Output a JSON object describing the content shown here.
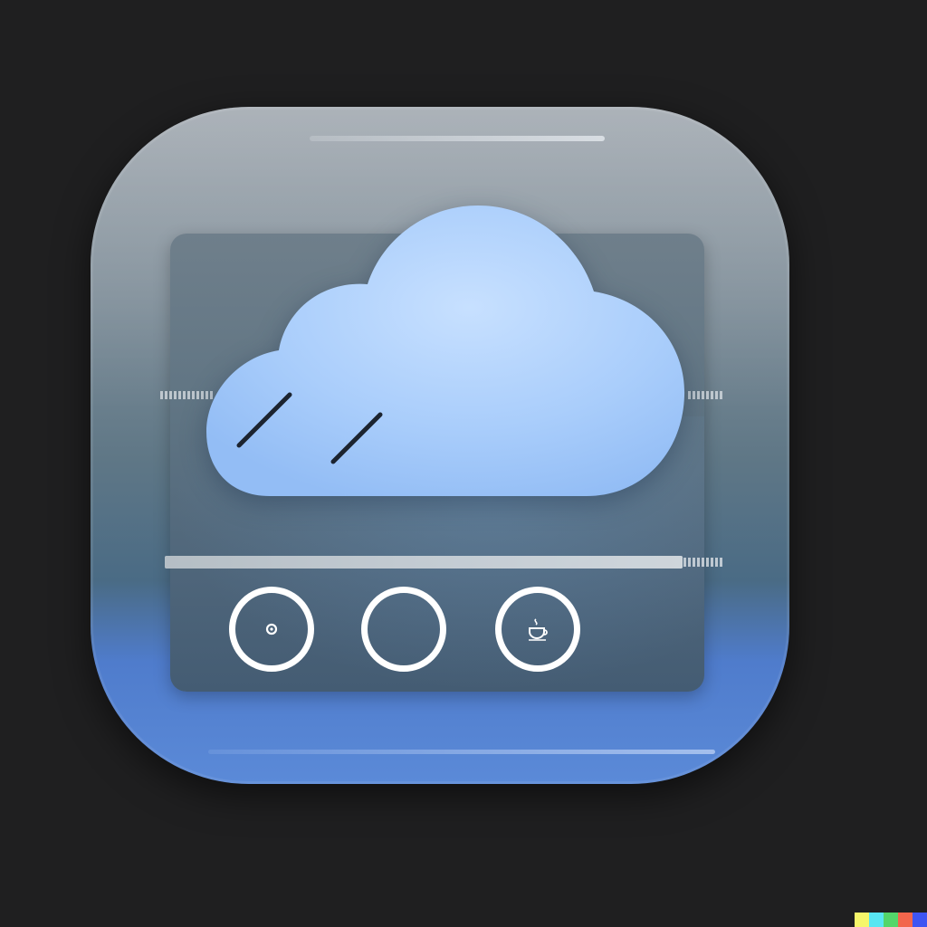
{
  "app_icon": {
    "icon": "weather-app-icon",
    "cloud_icon": "cloud-icon",
    "rain_marks": 2
  },
  "progress": {
    "value": 1.0
  },
  "buttons": [
    {
      "icon": "record-dot-icon"
    },
    {
      "icon": "empty-circle-icon"
    },
    {
      "icon": "teacup-icon"
    }
  ],
  "colors": {
    "background": "#1f1f20",
    "cloud": "#a9cdfb",
    "icon_accent": "#5b8ad8",
    "button_ring": "#ffffff"
  },
  "watermark_colors": [
    "#f6f66a",
    "#58e6f2",
    "#53d66a",
    "#f2664c",
    "#3e55f2"
  ]
}
